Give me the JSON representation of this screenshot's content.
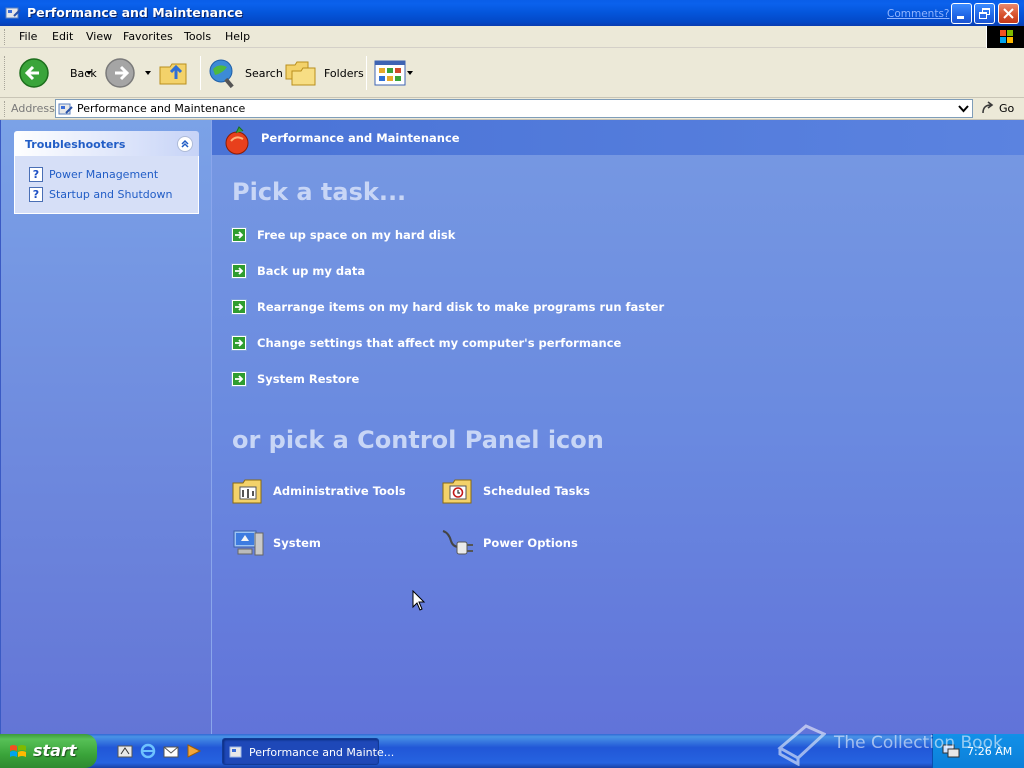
{
  "window": {
    "title": "Performance and Maintenance",
    "comments_link": "Comments?"
  },
  "menubar": {
    "items": [
      "File",
      "Edit",
      "View",
      "Favorites",
      "Tools",
      "Help"
    ]
  },
  "toolbar": {
    "back_label": "Back",
    "search_label": "Search",
    "folders_label": "Folders"
  },
  "address": {
    "label": "Address",
    "value": "Performance and Maintenance",
    "go_label": "Go"
  },
  "leftpane": {
    "panel_title": "Troubleshooters",
    "links": [
      "Power Management",
      "Startup and Shutdown"
    ]
  },
  "main": {
    "header_title": "Performance and Maintenance",
    "pick_task": "Pick a task...",
    "tasks": [
      "Free up space on my hard disk",
      "Back up my data",
      "Rearrange items on my hard disk to make programs run faster",
      "Change settings that affect my computer's performance",
      "System Restore"
    ],
    "pick_cp": "or pick a Control Panel icon",
    "cp_icons": [
      {
        "label": "Administrative Tools",
        "icon": "administrative-tools-icon"
      },
      {
        "label": "Scheduled Tasks",
        "icon": "scheduled-tasks-icon"
      },
      {
        "label": "System",
        "icon": "system-icon"
      },
      {
        "label": "Power Options",
        "icon": "power-options-icon"
      }
    ]
  },
  "taskbar": {
    "start_label": "start",
    "task_button": "Performance and Mainte...",
    "clock": "7:26 AM"
  },
  "watermark": {
    "text": "The Collection Book"
  },
  "colors": {
    "title_bar": "#0455da",
    "content_bg": "#6a8ae0",
    "link_blue": "#215dc6",
    "start_green": "#3aa43a"
  }
}
